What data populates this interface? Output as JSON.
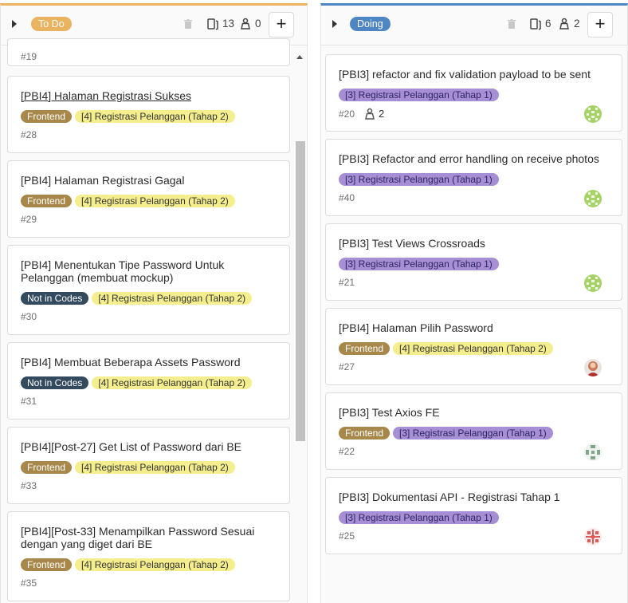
{
  "colors": {
    "todo_accent": "#e9b35f",
    "doing_accent": "#4e86c4",
    "frontend": "#a8884a",
    "not_in_codes": "#344a5e",
    "tahap2": "#f5ee8e",
    "tahap1": "#a78fd6"
  },
  "todo": {
    "label": "To Do",
    "issue_count": "13",
    "weight": "0",
    "partial_card_id": "#19",
    "cards": [
      {
        "title": "[PBI4] Halaman Registrasi Sukses",
        "labels": [
          "Frontend",
          "[4] Registrasi Pelanggan (Tahap 2)"
        ],
        "id": "#28"
      },
      {
        "title": "[PBI4] Halaman Registrasi Gagal",
        "labels": [
          "Frontend",
          "[4] Registrasi Pelanggan (Tahap 2)"
        ],
        "id": "#29"
      },
      {
        "title": "[PBI4] Menentukan Tipe Password Untuk Pelanggan (membuat mockup)",
        "labels": [
          "Not in Codes",
          "[4] Registrasi Pelanggan (Tahap 2)"
        ],
        "id": "#30"
      },
      {
        "title": "[PBI4] Membuat Beberapa Assets Password",
        "labels": [
          "Not in Codes",
          "[4] Registrasi Pelanggan (Tahap 2)"
        ],
        "id": "#31"
      },
      {
        "title": "[PBI4][Post-27] Get List of Password dari BE",
        "labels": [
          "Frontend",
          "[4] Registrasi Pelanggan (Tahap 2)"
        ],
        "id": "#33"
      },
      {
        "title": "[PBI4][Post-33] Menampilkan Password Sesuai dengan yang diget dari BE",
        "labels": [
          "Frontend",
          "[4] Registrasi Pelanggan (Tahap 2)"
        ],
        "id": "#35"
      }
    ]
  },
  "doing": {
    "label": "Doing",
    "issue_count": "6",
    "weight": "2",
    "cards": [
      {
        "title": "[PBI3] refactor and fix validation payload to be sent",
        "labels": [
          "[3] Registrasi Pelanggan (Tahap 1)"
        ],
        "id": "#20",
        "weight": "2",
        "avatar": "green-identicon"
      },
      {
        "title": "[PBI3] Refactor and error handling on receive photos",
        "labels": [
          "[3] Registrasi Pelanggan (Tahap 1)"
        ],
        "id": "#40",
        "avatar": "green-identicon"
      },
      {
        "title": "[PBI3] Test Views Crossroads",
        "labels": [
          "[3] Registrasi Pelanggan (Tahap 1)"
        ],
        "id": "#21",
        "avatar": "green-identicon"
      },
      {
        "title": "[PBI4] Halaman Pilih Password",
        "labels": [
          "Frontend",
          "[4] Registrasi Pelanggan (Tahap 2)"
        ],
        "id": "#27",
        "avatar": "photo-avatar"
      },
      {
        "title": "[PBI3] Test Axios FE",
        "labels": [
          "Frontend",
          "[3] Registrasi Pelanggan (Tahap 1)"
        ],
        "id": "#22",
        "avatar": "gray-identicon"
      },
      {
        "title": "[PBI3] Dokumentasi API - Registrasi Tahap 1",
        "labels": [
          "[3] Registrasi Pelanggan (Tahap 1)"
        ],
        "id": "#25",
        "avatar": "red-identicon"
      }
    ]
  }
}
